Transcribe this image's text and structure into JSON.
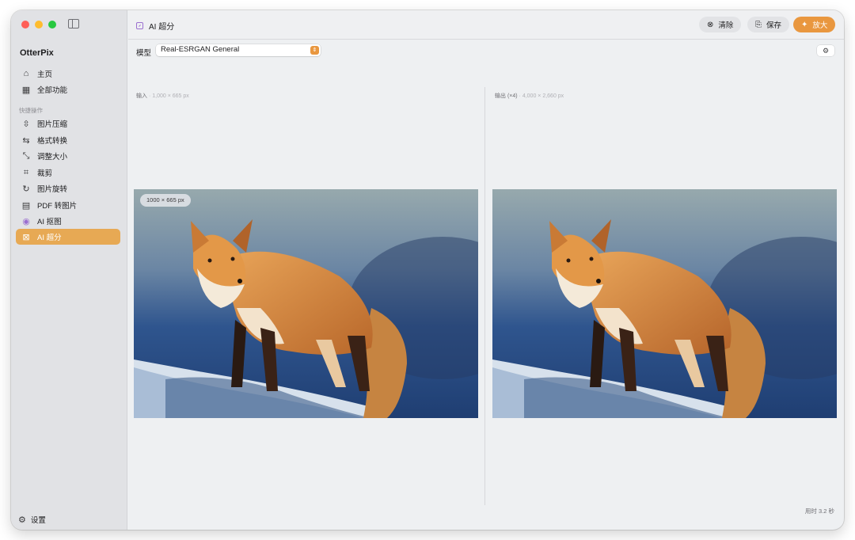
{
  "app": {
    "name": "OtterPix"
  },
  "sidebar": {
    "items": [
      {
        "label": "主页",
        "icon": "home-icon"
      },
      {
        "label": "全部功能",
        "icon": "grid-icon"
      }
    ],
    "section_label": "快捷操作",
    "quick_items": [
      {
        "label": "图片压缩",
        "icon": "compress-icon"
      },
      {
        "label": "格式转换",
        "icon": "convert-icon"
      },
      {
        "label": "调整大小",
        "icon": "resize-icon"
      },
      {
        "label": "裁剪",
        "icon": "crop-icon"
      },
      {
        "label": "图片旋转",
        "icon": "rotate-icon"
      },
      {
        "label": "PDF 转图片",
        "icon": "pdf-icon"
      },
      {
        "label": "AI 抠图",
        "icon": "person-icon"
      },
      {
        "label": "AI 超分",
        "icon": "upscale-icon",
        "active": true
      }
    ],
    "settings_label": "设置"
  },
  "header": {
    "title": "AI 超分",
    "clear_label": "清除",
    "save_label": "保存",
    "upscale_label": "放大"
  },
  "toolbar": {
    "model_label": "模型",
    "model_value": "Real-ESRGAN General"
  },
  "input_pane": {
    "label": "输入",
    "dims": "1,000 × 665 px",
    "badge": "1000 × 665 px"
  },
  "output_pane": {
    "label": "输出 (×4)",
    "dims": "4,000 × 2,660 px"
  },
  "status": {
    "timing": "用时 3.2 秒"
  },
  "colors": {
    "accent": "#e9973f",
    "active_item": "#e7a954",
    "upscale_icon": "#9b6fd0"
  }
}
